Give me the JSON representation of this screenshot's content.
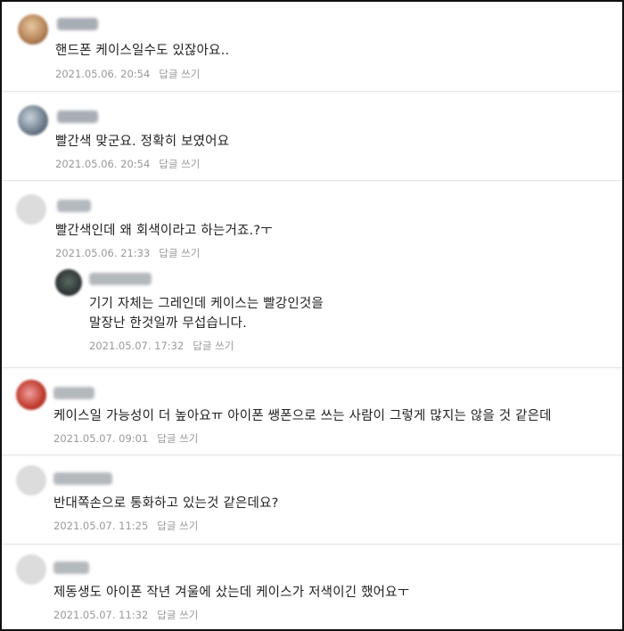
{
  "comments": [
    {
      "text": "핸드폰 케이스일수도 있잖아요..",
      "date": "2021.05.06. 20:54",
      "reply_label": "답글 쓰기"
    },
    {
      "text": "빨간색 맞군요. 정확히 보였어요",
      "date": "2021.05.06. 20:54",
      "reply_label": "답글 쓰기"
    },
    {
      "text": "빨간색인데 왜 회색이라고 하는거죠.?ㅜ",
      "date": "2021.05.06. 21:33",
      "reply_label": "답글 쓰기"
    },
    {
      "text": "케이스일 가능성이 더 높아요ㅠ 아이폰 쌩폰으로 쓰는 사람이 그렇게 많지는 않을 것 같은데",
      "date": "2021.05.07. 09:01",
      "reply_label": "답글 쓰기"
    },
    {
      "text": "반대쪽손으로 통화하고 있는것 같은데요?",
      "date": "2021.05.07. 11:25",
      "reply_label": "답글 쓰기"
    },
    {
      "text": "제동생도 아이폰 작년 겨울에 샀는데 케이스가 저색이긴 했어요ㅜ",
      "date": "2021.05.07. 11:32",
      "reply_label": "답글 쓰기"
    }
  ],
  "reply": {
    "line1": "기기 자체는 그레인데 케이스는 빨강인것을",
    "line2": "말장난 한것일까 무섭습니다.",
    "date": "2021.05.07. 17:32",
    "reply_label": "답글 쓰기"
  },
  "colors": {
    "avatar_1": "#b8865a",
    "avatar_2": "#6b7a8a",
    "avatar_3": "#d9d9d9",
    "avatar_reply": "#2b2f33",
    "avatar_4": "#c0392b",
    "avatar_5": "#dcdcdc",
    "avatar_6": "#dcdcdc"
  }
}
